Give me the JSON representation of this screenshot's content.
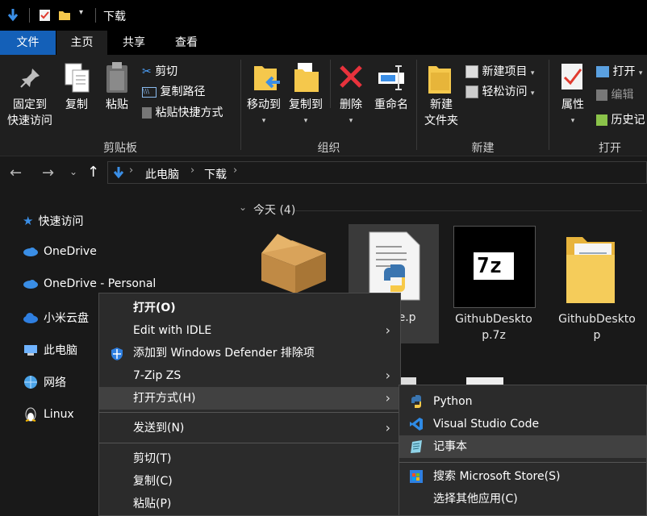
{
  "window": {
    "title": "下载"
  },
  "ribbon": {
    "tabs": [
      "文件",
      "主页",
      "共享",
      "查看"
    ],
    "clipboard": {
      "group_label": "剪贴板",
      "pin_label_1": "固定到",
      "pin_label_2": "快速访问",
      "copy_label": "复制",
      "paste_label": "粘贴",
      "cut_label": "剪切",
      "copy_path_label": "复制路径",
      "paste_shortcut_label": "粘贴快捷方式"
    },
    "organize": {
      "group_label": "组织",
      "move_to_label": "移动到",
      "copy_to_label": "复制到",
      "delete_label": "删除",
      "rename_label": "重命名"
    },
    "new": {
      "group_label": "新建",
      "new_folder_label_1": "新建",
      "new_folder_label_2": "文件夹",
      "new_item_label": "新建项目",
      "easy_access_label": "轻松访问"
    },
    "open": {
      "group_label": "打开",
      "properties_label": "属性",
      "open_label": "打开",
      "edit_label": "编辑",
      "history_label": "历史记"
    }
  },
  "address": {
    "crumbs": [
      "此电脑",
      "下载"
    ]
  },
  "sidebar": {
    "items": [
      {
        "label": "快速访问",
        "icon": "star-icon"
      },
      {
        "label": "OneDrive",
        "icon": "cloud-icon"
      },
      {
        "label": "OneDrive - Personal",
        "icon": "cloud-icon"
      },
      {
        "label": "小米云盘",
        "icon": "cloud-icon"
      },
      {
        "label": "此电脑",
        "icon": "computer-icon"
      },
      {
        "label": "网络",
        "icon": "network-icon"
      },
      {
        "label": "Linux",
        "icon": "linux-icon"
      }
    ]
  },
  "content": {
    "group_header": "今天 (4)",
    "files": [
      {
        "label": "",
        "icon": "package-icon"
      },
      {
        "label": "ice.p",
        "icon": "python-file-icon"
      },
      {
        "label_1": "GithubDeskto",
        "label_2": "p.7z",
        "icon": "7zip-icon"
      },
      {
        "label_1": "GithubDeskto",
        "label_2": "p",
        "icon": "folder-icon"
      }
    ]
  },
  "context_menu": {
    "items": [
      {
        "label": "打开(O)",
        "bold": true
      },
      {
        "label": "Edit with IDLE",
        "submenu": true
      },
      {
        "label": "添加到 Windows Defender 排除项",
        "icon": "defender-shield-icon"
      },
      {
        "label": "7-Zip ZS",
        "submenu": true
      },
      {
        "label": "打开方式(H)",
        "submenu": true,
        "highlighted": true
      },
      {
        "label": "发送到(N)",
        "submenu": true
      },
      {
        "label": "剪切(T)"
      },
      {
        "label": "复制(C)"
      },
      {
        "label": "粘贴(P)"
      }
    ]
  },
  "submenu_open_with": {
    "items": [
      {
        "label": "Python",
        "icon": "python-icon"
      },
      {
        "label": "Visual Studio Code",
        "icon": "vscode-icon"
      },
      {
        "label": "记事本",
        "icon": "notepad-icon",
        "highlighted": true
      },
      {
        "label": "搜索 Microsoft Store(S)",
        "icon": "store-icon"
      },
      {
        "label": "选择其他应用(C)"
      }
    ]
  },
  "colors": {
    "file_tab": "#1460b8",
    "accent_blue": "#3a8ee6",
    "menu_bg": "#2b2b2b",
    "highlight": "#414141"
  }
}
